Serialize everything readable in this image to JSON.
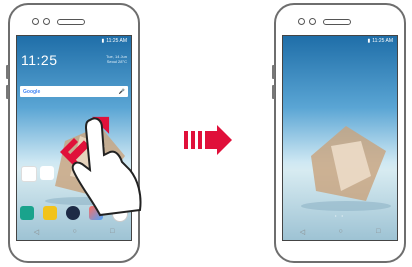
{
  "left_phone": {
    "status_time": "11:25 AM",
    "clock": "11:25",
    "date_line1": "Tue, 14 Jun",
    "date_line2": "Seoul 28°C",
    "search_brand": "Google",
    "mic_icon": "mic-icon",
    "nav": [
      "◁",
      "○",
      "□"
    ]
  },
  "right_phone": {
    "status_time": "11:25 AM",
    "page_indicator": "• •",
    "nav": [
      "◁",
      "○",
      "□"
    ]
  },
  "colors": {
    "arrow": "#e0103a",
    "frame": "#6e6e6e"
  }
}
